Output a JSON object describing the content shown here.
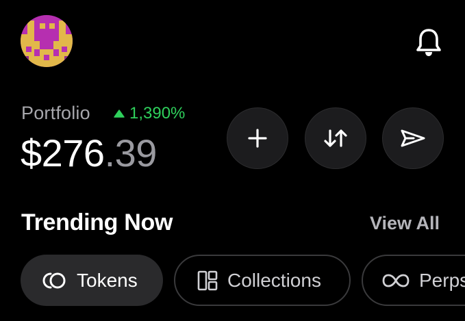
{
  "header": {
    "avatar_icon": "pixel-art-avatar",
    "notification_icon": "bell-icon"
  },
  "portfolio": {
    "label": "Portfolio",
    "change_icon": "triangle-up-icon",
    "change": "1,390%",
    "balance_whole": "$276",
    "balance_cents": ".39"
  },
  "actions": [
    {
      "icon": "plus-icon"
    },
    {
      "icon": "swap-arrows-icon"
    },
    {
      "icon": "send-icon"
    }
  ],
  "trending": {
    "title": "Trending Now",
    "view_all": "View All",
    "chips": [
      {
        "label": "Tokens",
        "icon": "tokens-icon",
        "selected": true
      },
      {
        "label": "Collections",
        "icon": "collections-icon",
        "selected": false
      },
      {
        "label": "Perps",
        "icon": "infinity-icon",
        "selected": false
      }
    ]
  },
  "colors": {
    "background": "#000000",
    "positive": "#2fd05c",
    "muted_text": "#a7a7ac",
    "button_bg": "#1c1c1e",
    "chip_selected_bg": "#2a2a2c"
  }
}
